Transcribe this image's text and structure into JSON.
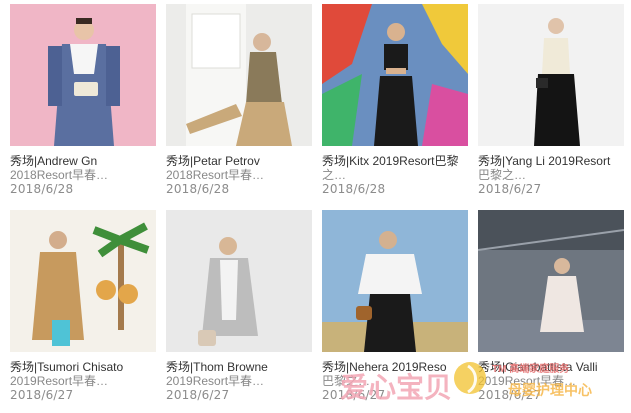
{
  "cards": [
    {
      "title": "秀场|Andrew Gn",
      "subtitle": "2018Resort早春…",
      "date": "2018/6/28",
      "bg": "#f0b6c6",
      "outfit": "#5a6fa0"
    },
    {
      "title": "秀场|Petar Petrov",
      "subtitle": "2018Resort早春…",
      "date": "2018/6/28",
      "bg": "#ececea",
      "outfit": "#c9a97a"
    },
    {
      "title": "秀场|Kitx 2019Resort巴黎",
      "subtitle": "之…",
      "date": "2018/6/28",
      "bg": "#6a8fc0",
      "outfit": "#1a1a1a"
    },
    {
      "title": "秀场|Yang Li 2019Resort",
      "subtitle": "巴黎之…",
      "date": "2018/6/27",
      "bg": "#f2f2f2",
      "outfit": "#141414"
    },
    {
      "title": "秀场|Tsumori Chisato",
      "subtitle": "2019Resort早春…",
      "date": "2018/6/27",
      "bg": "#f4f1ea",
      "outfit": "#c79a5e"
    },
    {
      "title": "秀场|Thom Browne",
      "subtitle": "2019Resort早春…",
      "date": "2018/6/27",
      "bg": "#e9e9e9",
      "outfit": "#bdbdbd"
    },
    {
      "title": "秀场|Nehera 2019Reso",
      "subtitle": "巴黎之…",
      "date": "2018/6/27",
      "bg": "#8fb6d8",
      "outfit": "#f4f4f4"
    },
    {
      "title": "秀场|Giambattista Valli",
      "subtitle": "2019Resort早春…",
      "date": "2018/6/27",
      "bg": "#6e7680",
      "outfit": "#efe7e2"
    }
  ],
  "watermark": {
    "brand_left": "爱心宝贝",
    "brand_right": "母婴护理中心",
    "small_top": "TM 高端家庭服务"
  }
}
